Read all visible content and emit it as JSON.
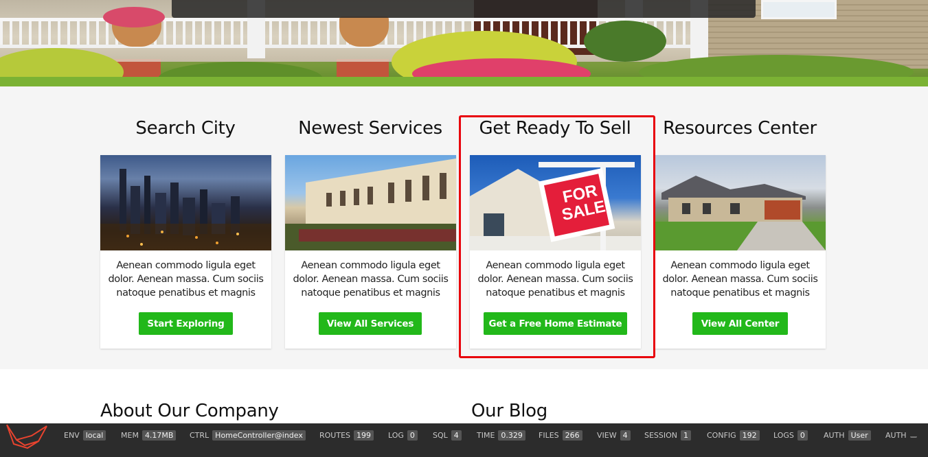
{
  "features": [
    {
      "title": "Search City",
      "text": "Aenean commodo ligula eget dolor. Aenean massa. Cum sociis natoque penatibus et magnis",
      "button": "Start Exploring"
    },
    {
      "title": "Newest Services",
      "text": "Aenean commodo ligula eget dolor. Aenean massa. Cum sociis natoque penatibus et magnis",
      "button": "View All Services"
    },
    {
      "title": "Get Ready To Sell",
      "text": "Aenean commodo ligula eget dolor. Aenean massa. Cum sociis natoque penatibus et magnis",
      "button": "Get a Free Home Estimate"
    },
    {
      "title": "Resources Center",
      "text": "Aenean commodo ligula eget dolor. Aenean massa. Cum sociis natoque penatibus et magnis",
      "button": "View All Center"
    }
  ],
  "sale_sign": {
    "line1": "FOR",
    "line2": "SALE"
  },
  "sections": {
    "about": "About Our Company",
    "blog": "Our Blog"
  },
  "debugbar": [
    {
      "label": "ENV",
      "value": "local"
    },
    {
      "label": "MEM",
      "value": "4.17MB"
    },
    {
      "label": "CTRL",
      "value": "HomeController@index"
    },
    {
      "label": "ROUTES",
      "value": "199"
    },
    {
      "label": "LOG",
      "value": "0"
    },
    {
      "label": "SQL",
      "value": "4"
    },
    {
      "label": "TIME",
      "value": "0.329"
    },
    {
      "label": "FILES",
      "value": "266"
    },
    {
      "label": "VIEW",
      "value": "4"
    },
    {
      "label": "SESSION",
      "value": "1"
    },
    {
      "label": "CONFIG",
      "value": "192"
    },
    {
      "label": "LOGS",
      "value": "0"
    },
    {
      "label": "AUTH",
      "value": "User"
    },
    {
      "label": "AUTH",
      "value": ""
    }
  ],
  "colors": {
    "accent_button": "#22b81a",
    "highlight": "#e8000b",
    "debugbar": "#2c2c2c",
    "logo": "#e8432e"
  }
}
